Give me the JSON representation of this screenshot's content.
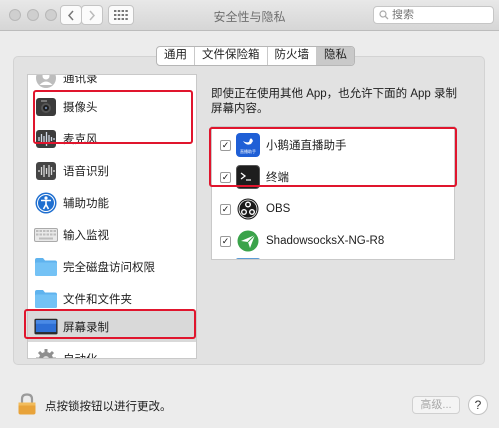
{
  "window": {
    "title": "安全性与隐私"
  },
  "search": {
    "placeholder": "搜索"
  },
  "tabs": [
    {
      "label": "通用",
      "active": false
    },
    {
      "label": "文件保险箱",
      "active": false
    },
    {
      "label": "防火墙",
      "active": false
    },
    {
      "label": "隐私",
      "active": true
    }
  ],
  "sidebar": {
    "items": [
      {
        "label": "通讯录",
        "icon": "contacts-icon"
      },
      {
        "label": "摄像头",
        "icon": "camera-icon"
      },
      {
        "label": "麦克风",
        "icon": "microphone-icon"
      },
      {
        "label": "语音识别",
        "icon": "speech-recognition-icon"
      },
      {
        "label": "辅助功能",
        "icon": "accessibility-icon"
      },
      {
        "label": "输入监视",
        "icon": "keyboard-icon"
      },
      {
        "label": "完全磁盘访问权限",
        "icon": "folder-icon"
      },
      {
        "label": "文件和文件夹",
        "icon": "folder-icon"
      },
      {
        "label": "屏幕录制",
        "icon": "display-icon",
        "selected": true
      },
      {
        "label": "自动化",
        "icon": "gear-icon"
      }
    ]
  },
  "main": {
    "description": "即使正在使用其他 App，也允许下面的 App 录制屏幕内容。",
    "apps": [
      {
        "name": "小鹅通直播助手",
        "checked": true,
        "icon": "xiaoe-live-icon",
        "icon_caption": "直播助手"
      },
      {
        "name": "终端",
        "checked": true,
        "icon": "terminal-icon"
      },
      {
        "name": "OBS",
        "checked": true,
        "icon": "obs-icon"
      },
      {
        "name": "ShadowsocksX-NG-R8",
        "checked": true,
        "icon": "shadowsocks-icon"
      }
    ]
  },
  "footer": {
    "lock_text": "点按锁按钮以进行更改。",
    "advanced_label": "高级...",
    "help_label": "?"
  },
  "colors": {
    "annotation_red": "#e0152d",
    "selection_gray": "#d9d9d9"
  }
}
